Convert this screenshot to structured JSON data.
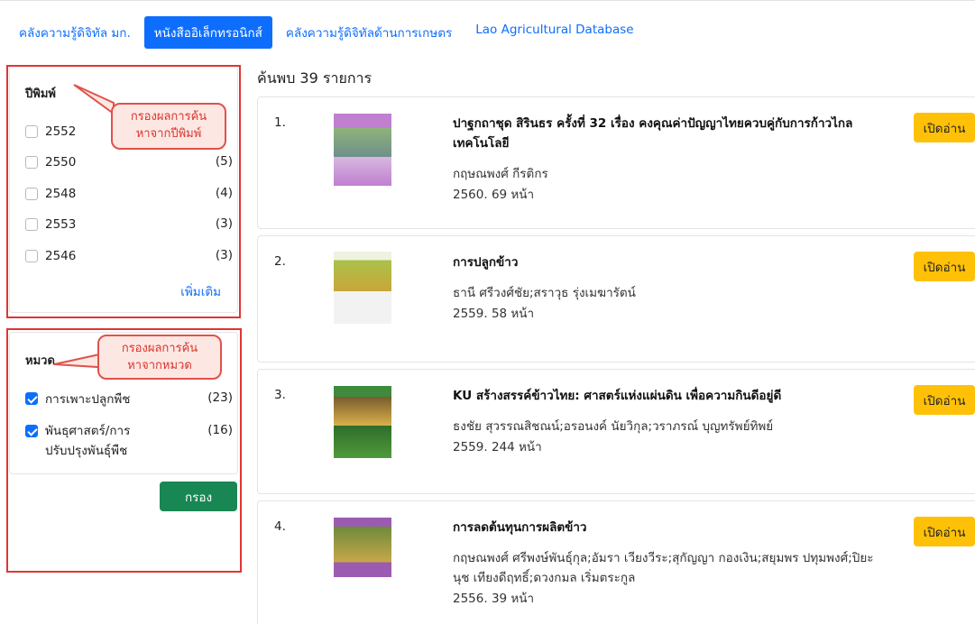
{
  "tabs": [
    {
      "label": "คลังความรู้ดิจิทัล มก."
    },
    {
      "label": "หนังสืออิเล็กทรอนิกส์"
    },
    {
      "label": "คลังความรู้ดิจิทัลด้านการเกษตร"
    },
    {
      "label": "Lao Agricultural Database"
    }
  ],
  "year_filter": {
    "title": "ปีพิมพ์",
    "items": [
      {
        "label": "2552",
        "count": "",
        "checked": false
      },
      {
        "label": "2550",
        "count": "(5)",
        "checked": false
      },
      {
        "label": "2548",
        "count": "(4)",
        "checked": false
      },
      {
        "label": "2553",
        "count": "(3)",
        "checked": false
      },
      {
        "label": "2546",
        "count": "(3)",
        "checked": false
      }
    ],
    "more_label": "เพิ่มเติม",
    "callout_line1": "กรองผลการค้น",
    "callout_line2": "หาจากปีพิมพ์"
  },
  "category_filter": {
    "title": "หมวด",
    "items": [
      {
        "label": "การเพาะปลูกพืช",
        "count": "(23)",
        "checked": true
      },
      {
        "label_line1": "พันธุศาสตร์/การ",
        "label_line2": "ปรับปรุงพันธุ์พืช",
        "count": "(16)",
        "checked": true
      }
    ],
    "callout_line1": "กรองผลการค้น",
    "callout_line2": "หาจากหมวด"
  },
  "filter_button": "กรอง",
  "results_summary": "ค้นพบ 39 รายการ",
  "read_button": "เปิดอ่าน",
  "results": [
    {
      "num": "1.",
      "title": "ปาฐกถาชุด สิรินธร ครั้งที่ 32 เรื่อง คงคุณค่าปัญญาไทยควบคู่กับการก้าวไกลเทคโนโลยี",
      "author": "กฤษณพงศ์ กีรติกร",
      "meta": "2560. 69 หน้า",
      "cover_color": "#c07fcf"
    },
    {
      "num": "2.",
      "title": "การปลูกข้าว",
      "author": "ธานี ศรีวงศ์ชัย;สราวุธ รุ่งเมฆารัตน์",
      "meta": "2559. 58 หน้า",
      "cover_color": "#a9c24a"
    },
    {
      "num": "3.",
      "title": "KU สร้างสรรค์ข้าวไทย: ศาสตร์แห่งแผ่นดิน เพื่อความกินดีอยู่ดี",
      "author": "ธงชัย สุวรรณสิชณน์;อรอนงค์ นัยวิกุล;วราภรณ์ บุญทรัพย์ทิพย์",
      "meta": "2559. 244 หน้า",
      "cover_color": "#3f8a3c"
    },
    {
      "num": "4.",
      "title": "การลดต้นทุนการผลิตข้าว",
      "author": "กฤษณพงศ์ ศรีพงษ์พันธุ์กุล;อัมรา เวียงวีระ;สุกัญญา กองเงิน;สยุมพร ปทุมพงศ์;ปิยะนุช เทียงดีฤทธิ์;ดวงกมล เริ่มตระกูล",
      "meta": "2556. 39 หน้า",
      "cover_color": "#9b5bb0"
    }
  ]
}
